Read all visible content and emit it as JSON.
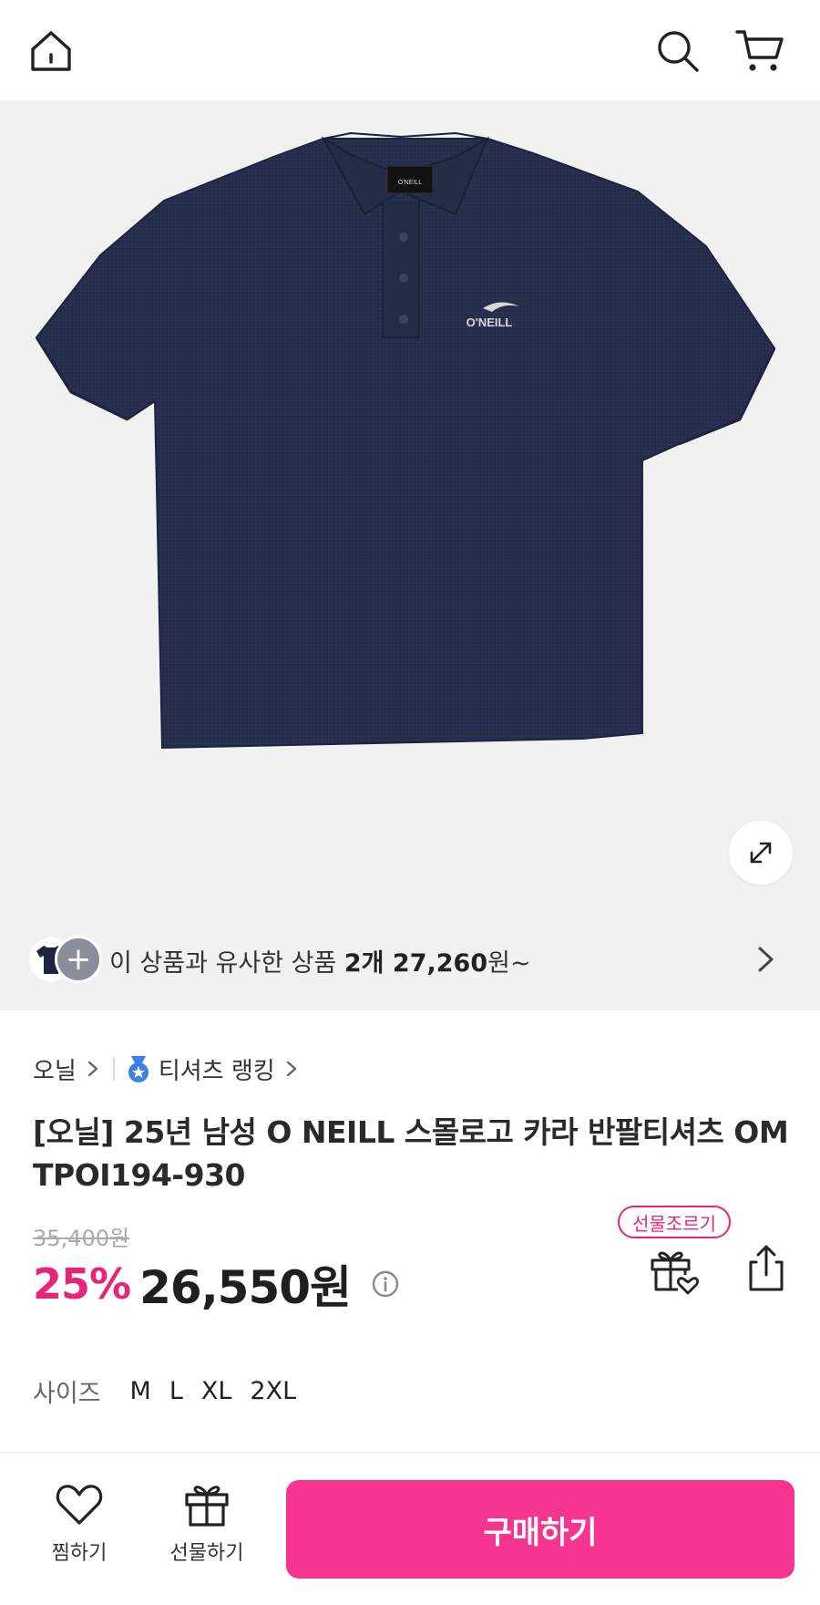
{
  "header": {
    "home_icon": "home-icon",
    "search_icon": "search-icon",
    "cart_icon": "cart-icon"
  },
  "product_image": {
    "logo_text": "O'NEILL",
    "tag_text": "O'NEILL",
    "expand_icon": "expand-arrows-icon",
    "shirt_color": "#262d4a"
  },
  "similar": {
    "prefix": "이 상품과 유사한 상품 ",
    "count": "2개 27,260",
    "suffix": "원~",
    "plus_icon": "+"
  },
  "breadcrumb": {
    "brand": "오닐",
    "ranking": "티셔츠 랭킹"
  },
  "product": {
    "title": "[오닐] 25년 남성 O NEILL 스몰로고 카라 반팔티셔츠 OM TPOI194-930",
    "original_price": "35,400원",
    "discount": "25%",
    "price": "26,550원"
  },
  "actions": {
    "gift_badge": "선물조르기"
  },
  "sizes": {
    "label": "사이즈",
    "options": [
      "M",
      "L",
      "XL",
      "2XL"
    ]
  },
  "bottom": {
    "like_label": "찜하기",
    "gift_label": "선물하기",
    "buy_label": "구매하기"
  },
  "colors": {
    "accent": "#e8247a",
    "buy_button": "#f5358f",
    "hero_bg": "#f1f1f2"
  }
}
